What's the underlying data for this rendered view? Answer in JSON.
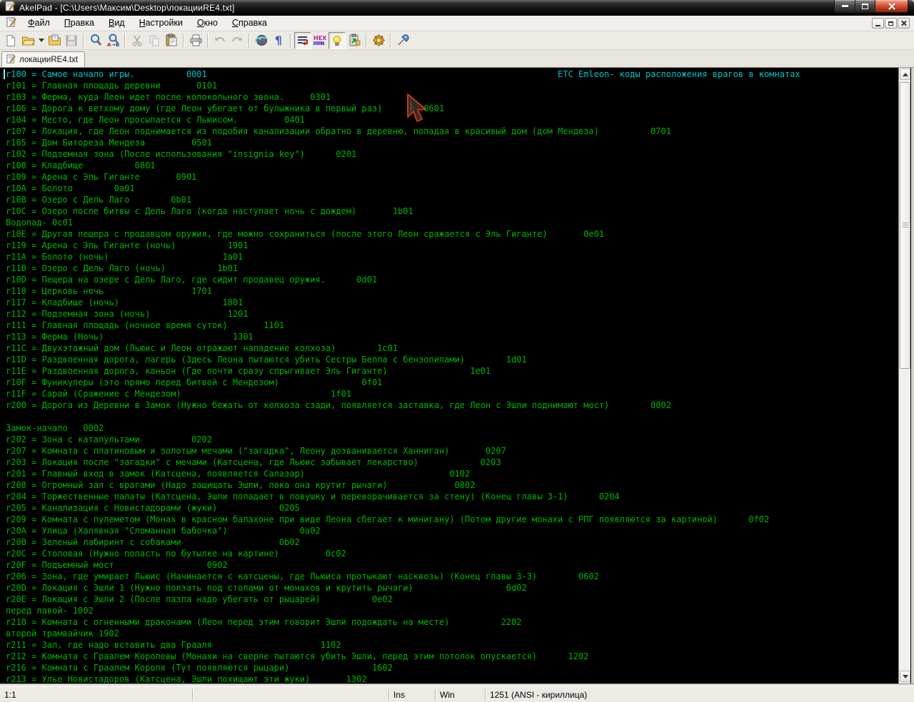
{
  "window": {
    "title": "AkelPad - [C:\\Users\\Максим\\Desktop\\локацииRE4.txt]",
    "controls": [
      "minimize",
      "maximize",
      "close"
    ],
    "mdi_controls": [
      "mdi-minimize",
      "mdi-restore",
      "mdi-close"
    ]
  },
  "menu": {
    "items": [
      {
        "id": "file",
        "label": "Файл"
      },
      {
        "id": "edit",
        "label": "Правка"
      },
      {
        "id": "view",
        "label": "Вид"
      },
      {
        "id": "settings",
        "label": "Настройки"
      },
      {
        "id": "window",
        "label": "Окно"
      },
      {
        "id": "help",
        "label": "Справка"
      }
    ]
  },
  "toolbar": {
    "icons": [
      "new-file-icon",
      "open-file-icon",
      "open-dropdown-icon",
      "reopen-folder-icon",
      "save-icon",
      "find-icon",
      "replace-icon",
      "cut-icon",
      "copy-icon",
      "paste-icon",
      "print-icon",
      "undo-icon",
      "redo-icon",
      "globe-icon",
      "pilcrow-icon",
      "word-wrap-icon",
      "hex-icon",
      "lightbulb-icon",
      "clipboard-arrow-icon",
      "gear-icon",
      "pin-icon"
    ],
    "hex_label": "HEX",
    "pilcrow_label": "¶",
    "replace_label": "A→B"
  },
  "tab": {
    "label": "локацииRE4.txt"
  },
  "editor": {
    "background": "#000000",
    "text_color": "#00b400",
    "first_line_color": "#00c4c4",
    "lines": [
      "r100 = Самое начало игры.          0001                                                                    ETC Emleon- коды расположения врагов в комнатах",
      "r101 = Главная площадь деревни       0101",
      "r103 = Ферма, куда Леон идет после колокольного звона.     0301",
      "r106 = Дорога к ветхому дому (где Леон убегает от булыжника в первый раз)        0601",
      "r104 = Место, где Леон просыпается с Льюисом.         0401",
      "r107 = Локация, где Леон поднимается из подобия канализации обратно в деревню, попадая в красивый дом (дом Мендеза)          0701",
      "r105 = Дом Битореза Мендеза         0501",
      "r102 = Подземная зона (После использования \"insignia key\")      0201",
      "r108 = Кладбище          0801",
      "r109 = Арена с Эль Гиганте       0901",
      "r10A = Болото        0a01",
      "r10B = Озеро с Дель Лаго        0b01",
      "r10C = Озеро после битвы с Дель Лаго (когда наступает ночь с дождем)       1b01",
      "Водопад- 0c01",
      "r10E = Другая пещера с продавцом оружия, где можно сохраниться (после этого Леон сражается с Эль Гиганте)       0e01",
      "r119 = Арена с Эль Гиганте (ночь)          1901",
      "r11A = Болото (ночь)                      1a01",
      "r11B = Озеро с Дель Лаго (ночь)          1b01",
      "r10D = Пещера на озере с Дель Лаго, где сидит продавец оружия.      0d01",
      "r118 = Церковь ночь                 1701",
      "r117 = Кладбище (ночь)                    1801",
      "r112 = Подземная зона (ночь)               1201",
      "r111 = Главная площадь (ночное время суток)       1101",
      "r113 = Ферма (Ночь)                         1301",
      "r11C = Двухэтажный дом (Льюис и Леон отражают нападение колхоза)        1c01",
      "r11D = Раздвоенная дорога, лагерь (Здесь Леона пытаются убить Сестры Белла с бензопилами)        1d01",
      "r11E = Раздвоенная дорога, каньон (Где почти сразу спрыгивает Эль Гиганте)                1e01",
      "r10F = Фуникулеры (это прямо перед битвой с Мендезом)                0f01",
      "r11F = Сарай (Сражение с Мендезом)                             1f01",
      "r200 = Дорога из Деревни в Замок (Нужно бежать от колхоза сзади, появляется заставка, где Леон с Эшли поднимают мост)        0002",
      "",
      "Замок-начало   0002",
      "r202 = Зона с катапультами          0202",
      "r207 = Комната с платиновым и золотым мечами (\"загадка\", Леону дозванивается Ханниган)       0207",
      "r203 = Локация после \"загадки\" с мечами (Катсцена, где Льюис забывает лекарство)            0203",
      "r201 = Главный вход в замок (Катсцена, появляется Салазар)                            0102",
      "r208 = Огромный зал с врагами (Надо защищать Эшли, пока она крутит рычаги)             0802",
      "r204 = Торжественные палаты (Катсцена, Эшли попадает в ловушку и переворачивается за стену) (Конец главы 3-1)      0204",
      "r205 = Канализация с Новистадорами (жуки)            0205",
      "r209 = Комната с пулеметом (Монах в красном балахоне при виде Леона сбегает к минигану) (Потом другие монахи с РПГ появляются за картиной)      0f02",
      "r20A = Улица (Халявная \"Сломанная бабочка\")              0a02",
      "r20B = Зеленый лабиринт с собаками                   0b02",
      "r20C = Столовая (Нужно попасть по бутылке на картине)         0c02",
      "r20F = Подъемный мост                  0902",
      "r206 = Зона, где умирает Льюис (Начинается с катсцены, где Льюиса протыкают насквозь) (Конец главы 3-3)        0602",
      "r20D = Локация с Эшли 1 (Нужно ползать под столами от монахов и крутить рычаги)                  0d02",
      "r20E = Локация с Эшли 2 (После пазла надо убегать от рыцарей)          0e02",
      "перед лавой- 1002",
      "r210 = Комната с огненными драконами (Леон перед этим говорит Эшли подождать на месте)          2202",
      "второй трамвайчик 1902",
      "r211 = Зал, где надо вставить два Грааля                     1102",
      "r212 = Комната с Граалем Королевы (Монахи на сверле пытаются убить Эшли, перед этим потолок опускается)      1202",
      "r216 = Комната с Граалем Короля (Тут появляются рыцари)                1602",
      "r213 = Улье Новистадоров (Катсцена, Эшли похищают эти жуки)       1302"
    ]
  },
  "statusbar": {
    "caret_position": "1:1",
    "selection_info": "",
    "insert_mode": "Ins",
    "newline_format": "Win",
    "codepage": "1251  (ANSI - кириллица)"
  }
}
